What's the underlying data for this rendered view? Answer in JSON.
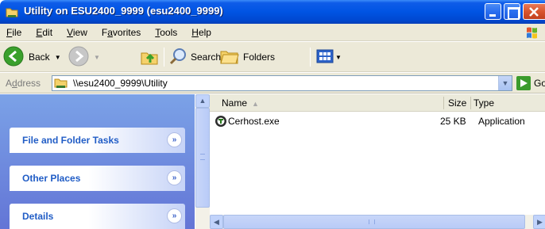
{
  "window": {
    "title": "Utility on ESU2400_9999 (esu2400_9999)",
    "colors": {
      "titlebar": "#0054e3",
      "taskpane": "#6375d6",
      "accent_text": "#215dc6"
    }
  },
  "menu": [
    {
      "label": "File",
      "u": "F",
      "rest": "ile"
    },
    {
      "label": "Edit",
      "u": "E",
      "rest": "dit"
    },
    {
      "label": "View",
      "u": "V",
      "rest": "iew"
    },
    {
      "label": "Favorites",
      "pre": "F",
      "u": "a",
      "rest": "vorites"
    },
    {
      "label": "Tools",
      "u": "T",
      "rest": "ools"
    },
    {
      "label": "Help",
      "u": "H",
      "rest": "elp"
    }
  ],
  "toolbar": {
    "back_label": "Back",
    "search_label": "Search",
    "folders_label": "Folders"
  },
  "address": {
    "label_pre": "A",
    "label_u": "d",
    "label_rest": "dress",
    "value": "\\\\esu2400_9999\\Utility",
    "go_label": "Go"
  },
  "taskpane": {
    "panels": [
      {
        "label": "File and Folder Tasks"
      },
      {
        "label": "Other Places"
      },
      {
        "label": "Details"
      }
    ]
  },
  "filelist": {
    "columns": {
      "name": "Name",
      "size": "Size",
      "type": "Type"
    },
    "rows": [
      {
        "name": "Cerhost.exe",
        "size": "25 KB",
        "type": "Application"
      }
    ]
  }
}
